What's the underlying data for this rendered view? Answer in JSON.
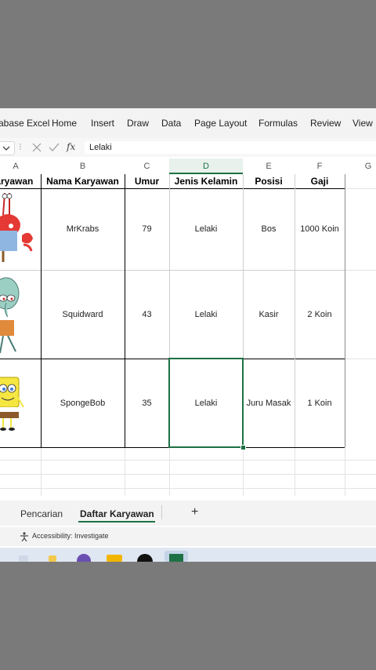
{
  "menu": {
    "items": [
      "Tabase Excel",
      "Home",
      "Insert",
      "Draw",
      "Data",
      "Page Layout",
      "Formulas",
      "Review",
      "View"
    ]
  },
  "formula_bar": {
    "name_box_chevron": "chevron-down-icon",
    "cancel_icon": "close-icon",
    "enter_icon": "check-icon",
    "fx_label": "fx",
    "value": "Lelaki"
  },
  "column_letters": [
    "A",
    "B",
    "C",
    "D",
    "E",
    "F",
    "G"
  ],
  "table": {
    "headers": [
      "Karyawan",
      "Nama Karyawan",
      "Umur",
      "Jenis Kelamin",
      "Posisi",
      "Gaji"
    ],
    "rows": [
      {
        "image": "mr-krabs",
        "nama": "MrKrabs",
        "umur": "79",
        "jenis_kelamin": "Lelaki",
        "posisi": "Bos",
        "gaji": "1000 Koin"
      },
      {
        "image": "squidward",
        "nama": "Squidward",
        "umur": "43",
        "jenis_kelamin": "Lelaki",
        "posisi": "Kasir",
        "gaji": "2 Koin"
      },
      {
        "image": "spongebob",
        "nama": "SpongeBob",
        "umur": "35",
        "jenis_kelamin": "Lelaki",
        "posisi": "Juru Masak",
        "gaji": "1 Koin"
      }
    ]
  },
  "sheet_tabs": {
    "tabs": [
      "Pencarian",
      "Daftar Karyawan"
    ],
    "active": "Daftar Karyawan",
    "add_label": "+"
  },
  "status": {
    "accessibility": "Accessibility: Investigate"
  },
  "colors": {
    "accent": "#1e7145"
  }
}
